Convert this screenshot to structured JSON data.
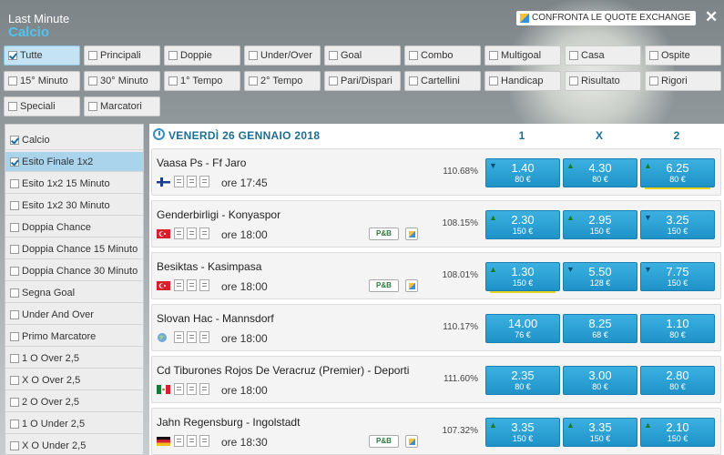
{
  "header": {
    "title": "Last Minute",
    "sport": "Calcio",
    "exchange_label": "CONFRONTA LE QUOTE EXCHANGE"
  },
  "filters": [
    {
      "label": "Tutte",
      "checked": true
    },
    {
      "label": "Principali",
      "checked": false
    },
    {
      "label": "Doppie",
      "checked": false
    },
    {
      "label": "Under/Over",
      "checked": false
    },
    {
      "label": "Goal",
      "checked": false
    },
    {
      "label": "Combo",
      "checked": false
    },
    {
      "label": "Multigoal",
      "checked": false
    },
    {
      "label": "Casa",
      "checked": false
    },
    {
      "label": "Ospite",
      "checked": false
    },
    {
      "label": "15° Minuto",
      "checked": false
    },
    {
      "label": "30° Minuto",
      "checked": false
    },
    {
      "label": "1° Tempo",
      "checked": false
    },
    {
      "label": "2° Tempo",
      "checked": false
    },
    {
      "label": "Pari/Dispari",
      "checked": false
    },
    {
      "label": "Cartellini",
      "checked": false
    },
    {
      "label": "Handicap",
      "checked": false
    },
    {
      "label": "Risultato",
      "checked": false
    },
    {
      "label": "Rigori",
      "checked": false
    },
    {
      "label": "Speciali",
      "checked": false
    },
    {
      "label": "Marcatori",
      "checked": false
    }
  ],
  "sidebar": [
    {
      "label": "Calcio",
      "checked": true
    },
    {
      "label": "Esito Finale 1x2",
      "checked": true,
      "selected": true
    },
    {
      "label": "Esito 1x2 15 Minuto",
      "checked": false
    },
    {
      "label": "Esito 1x2 30 Minuto",
      "checked": false
    },
    {
      "label": "Doppia Chance",
      "checked": false
    },
    {
      "label": "Doppia Chance 15 Minuto",
      "checked": false
    },
    {
      "label": "Doppia Chance 30 Minuto",
      "checked": false
    },
    {
      "label": "Segna Goal",
      "checked": false
    },
    {
      "label": "Under And Over",
      "checked": false
    },
    {
      "label": "Primo Marcatore",
      "checked": false
    },
    {
      "label": "1 O Over 2,5",
      "checked": false
    },
    {
      "label": "X O Over 2,5",
      "checked": false
    },
    {
      "label": "2 O Over 2,5",
      "checked": false
    },
    {
      "label": "1 O Under 2,5",
      "checked": false
    },
    {
      "label": "X O Under 2,5",
      "checked": false
    }
  ],
  "main": {
    "day": "VENERDÌ 26 GENNAIO 2018",
    "col1": "1",
    "colx": "X",
    "col2": "2",
    "matches": [
      {
        "name": "Vaasa Ps - Ff Jaro",
        "time": "ore 17:45",
        "flag": "finland",
        "pct": "110.68%",
        "pb": false,
        "odds": [
          {
            "v": "1.40",
            "s": "80 €",
            "arrow": "down",
            "hl": false
          },
          {
            "v": "4.30",
            "s": "80 €",
            "arrow": "up",
            "hl": false
          },
          {
            "v": "6.25",
            "s": "80 €",
            "arrow": "up",
            "hl": true
          }
        ]
      },
      {
        "name": "Genderbirligi - Konyaspor",
        "time": "ore 18:00",
        "flag": "turkey",
        "pct": "108.15%",
        "pb": true,
        "pb_label": "P&B",
        "odds": [
          {
            "v": "2.30",
            "s": "150 €",
            "arrow": "up",
            "hl": false
          },
          {
            "v": "2.95",
            "s": "150 €",
            "arrow": "up",
            "hl": false
          },
          {
            "v": "3.25",
            "s": "150 €",
            "arrow": "down",
            "hl": false
          }
        ]
      },
      {
        "name": "Besiktas - Kasimpasa",
        "time": "ore 18:00",
        "flag": "turkey",
        "pct": "108.01%",
        "pb": true,
        "pb_label": "P&B",
        "odds": [
          {
            "v": "1.30",
            "s": "150 €",
            "arrow": "up",
            "hl": true
          },
          {
            "v": "5.50",
            "s": "128 €",
            "arrow": "down",
            "hl": false
          },
          {
            "v": "7.75",
            "s": "150 €",
            "arrow": "down",
            "hl": false
          }
        ]
      },
      {
        "name": "Slovan Hac - Mannsdorf",
        "time": "ore 18:00",
        "flag": "world",
        "pct": "110.17%",
        "pb": false,
        "odds": [
          {
            "v": "14.00",
            "s": "76 €",
            "arrow": "",
            "hl": false
          },
          {
            "v": "8.25",
            "s": "68 €",
            "arrow": "",
            "hl": false
          },
          {
            "v": "1.10",
            "s": "80 €",
            "arrow": "",
            "hl": false
          }
        ]
      },
      {
        "name": "Cd Tiburones Rojos De Veracruz (Premier) - Deporti",
        "time": "ore 18:00",
        "flag": "mexico",
        "pct": "111.60%",
        "pb": false,
        "odds": [
          {
            "v": "2.35",
            "s": "80 €",
            "arrow": "",
            "hl": false
          },
          {
            "v": "3.00",
            "s": "80 €",
            "arrow": "",
            "hl": false
          },
          {
            "v": "2.80",
            "s": "80 €",
            "arrow": "",
            "hl": false
          }
        ]
      },
      {
        "name": "Jahn Regensburg - Ingolstadt",
        "time": "ore 18:30",
        "flag": "germany",
        "pct": "107.32%",
        "pb": true,
        "pb_label": "P&B",
        "odds": [
          {
            "v": "3.35",
            "s": "150 €",
            "arrow": "up",
            "hl": false
          },
          {
            "v": "3.35",
            "s": "150 €",
            "arrow": "up",
            "hl": false
          },
          {
            "v": "2.10",
            "s": "150 €",
            "arrow": "up",
            "hl": false
          }
        ]
      }
    ]
  }
}
